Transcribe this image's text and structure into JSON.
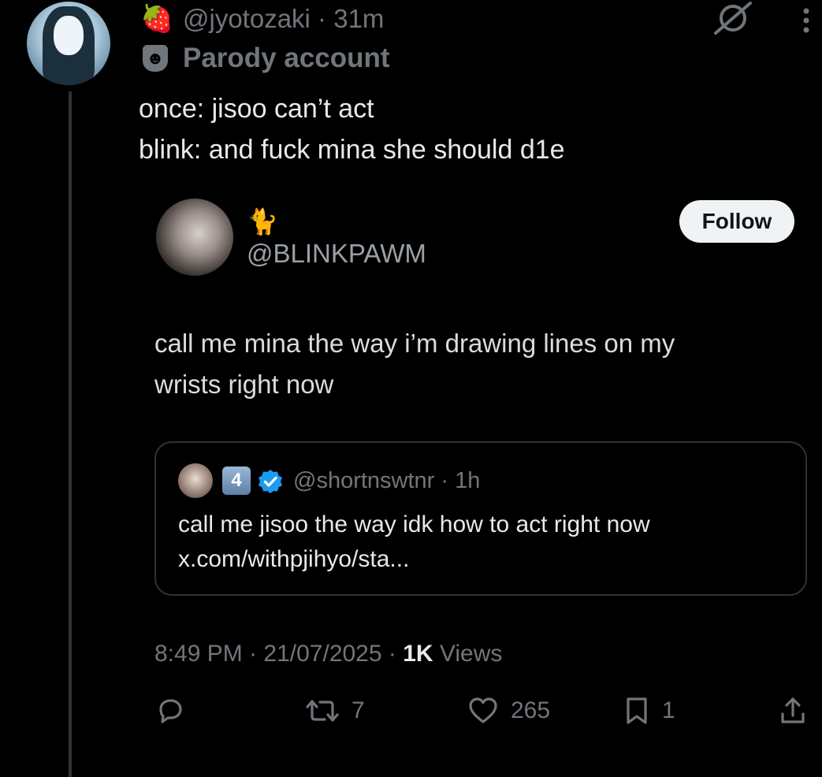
{
  "author": {
    "handle": "@jyotozaki",
    "time_sep": " · ",
    "time": "31m",
    "emoji": "🍓",
    "parody_label": "Parody account",
    "parody_icon": "mask-icon"
  },
  "tweet": {
    "line1": "once: jisoo can’t act",
    "line2": "blink: and fuck mina she should d1e"
  },
  "embedded": {
    "cat_emoji": "🐈",
    "handle": "@BLINKPAWM",
    "follow_label": "Follow",
    "text_line1": "call me mina the way i’m drawing lines on my",
    "text_line2": "wrists right now",
    "quote": {
      "badge_number": "4",
      "handle": "@shortnswtnr",
      "time_sep": " · ",
      "time": "1h",
      "text_line1": "call me jisoo the way idk how to act right now",
      "text_line2": "x.com/withpjihyo/sta..."
    }
  },
  "meta": {
    "time": "8:49 PM",
    "sep1": " · ",
    "date": "21/07/2025",
    "sep2": " · ",
    "views_count": "1K",
    "views_label": " Views"
  },
  "actions": {
    "reposts": "7",
    "likes": "265",
    "bookmarks": "1"
  },
  "colors": {
    "background": "#000000",
    "text": "#e7e9ea",
    "secondary": "#71767b",
    "verified": "#1d9bf0"
  }
}
